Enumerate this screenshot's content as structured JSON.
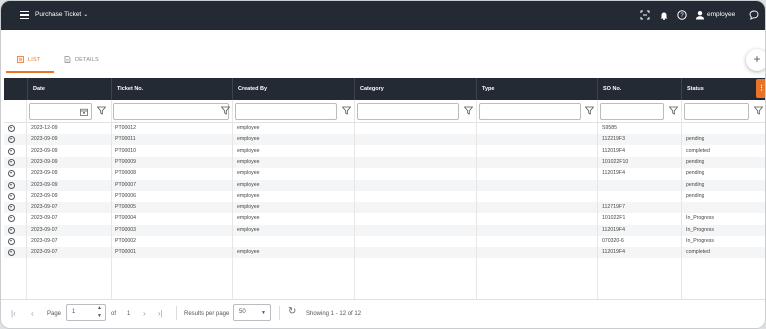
{
  "topbar": {
    "app_title": "Purchase Ticket",
    "user_name": "employee",
    "icons": [
      "menu-icon",
      "scan-icon",
      "bell-icon",
      "help-icon",
      "user-icon",
      "chat-icon"
    ]
  },
  "tabs": [
    {
      "label": "LIST",
      "active": true
    },
    {
      "label": "DETAILS",
      "active": false
    }
  ],
  "colors": {
    "accent": "#e8742a",
    "header_bg": "#232a33"
  },
  "grid": {
    "columns": [
      "Date",
      "Ticket No.",
      "Created By",
      "Category",
      "Type",
      "SO No.",
      "Status"
    ],
    "rows": [
      {
        "date": "2023-12-09",
        "ticket": "PT00012",
        "created_by": "employee",
        "category": "",
        "type": "",
        "so_no": "S9585",
        "status": ""
      },
      {
        "date": "2023-09-09",
        "ticket": "PT00011",
        "created_by": "employee",
        "category": "",
        "type": "",
        "so_no": "112219F3",
        "status": "pending"
      },
      {
        "date": "2023-09-09",
        "ticket": "PT00010",
        "created_by": "employee",
        "category": "",
        "type": "",
        "so_no": "112019F4",
        "status": "completed"
      },
      {
        "date": "2023-09-09",
        "ticket": "PT00009",
        "created_by": "employee",
        "category": "",
        "type": "",
        "so_no": "101022F10",
        "status": "pending"
      },
      {
        "date": "2023-09-09",
        "ticket": "PT00008",
        "created_by": "employee",
        "category": "",
        "type": "",
        "so_no": "112019F4",
        "status": "pending"
      },
      {
        "date": "2023-09-09",
        "ticket": "PT00007",
        "created_by": "employee",
        "category": "",
        "type": "",
        "so_no": "",
        "status": "pending"
      },
      {
        "date": "2023-09-09",
        "ticket": "PT00006",
        "created_by": "employee",
        "category": "",
        "type": "",
        "so_no": "",
        "status": "pending"
      },
      {
        "date": "2023-09-07",
        "ticket": "PT00005",
        "created_by": "employee",
        "category": "",
        "type": "",
        "so_no": "112719F7",
        "status": ""
      },
      {
        "date": "2023-09-07",
        "ticket": "PT00004",
        "created_by": "employee",
        "category": "",
        "type": "",
        "so_no": "101022F1",
        "status": "In_Progress"
      },
      {
        "date": "2023-09-07",
        "ticket": "PT00003",
        "created_by": "employee",
        "category": "",
        "type": "",
        "so_no": "112019F4",
        "status": "In_Progress"
      },
      {
        "date": "2023-09-07",
        "ticket": "PT00002",
        "created_by": "",
        "category": "",
        "type": "",
        "so_no": "070320-6",
        "status": "In_Progress"
      },
      {
        "date": "2023-09-07",
        "ticket": "PT00001",
        "created_by": "employee",
        "category": "",
        "type": "",
        "so_no": "112019F4",
        "status": "completed"
      }
    ]
  },
  "pager": {
    "page_label": "Page",
    "page_value": "1",
    "of_label": "of",
    "total_pages": "1",
    "rpp_label": "Results per page",
    "rpp_value": "50",
    "showing": "Showing 1 - 12 of 12"
  }
}
